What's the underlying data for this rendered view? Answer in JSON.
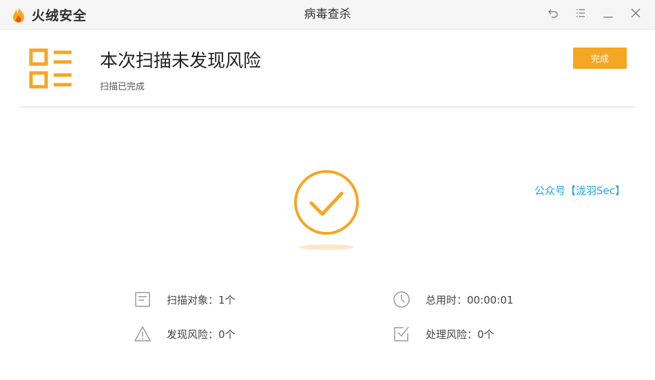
{
  "app": {
    "brand_name": "火绒安全",
    "window_title": "病毒查杀"
  },
  "window_controls": [
    {
      "name": "back-icon"
    },
    {
      "name": "menu-icon"
    },
    {
      "name": "minimize-icon"
    },
    {
      "name": "close-icon"
    }
  ],
  "header": {
    "title": "本次扫描未发现风险",
    "subtitle": "扫描已完成",
    "done_button": "完成"
  },
  "watermark": "公众号【泷羽Sec】",
  "stats": {
    "objects": "扫描对象：1个",
    "total_time": "总用时：00:00:01",
    "risks_found": "发现风险：0个",
    "risks_handled": "处理风险：0个"
  },
  "colors": {
    "accent": "#f5a623",
    "watermark": "#1aa3d9",
    "icon_gray": "#999999"
  }
}
